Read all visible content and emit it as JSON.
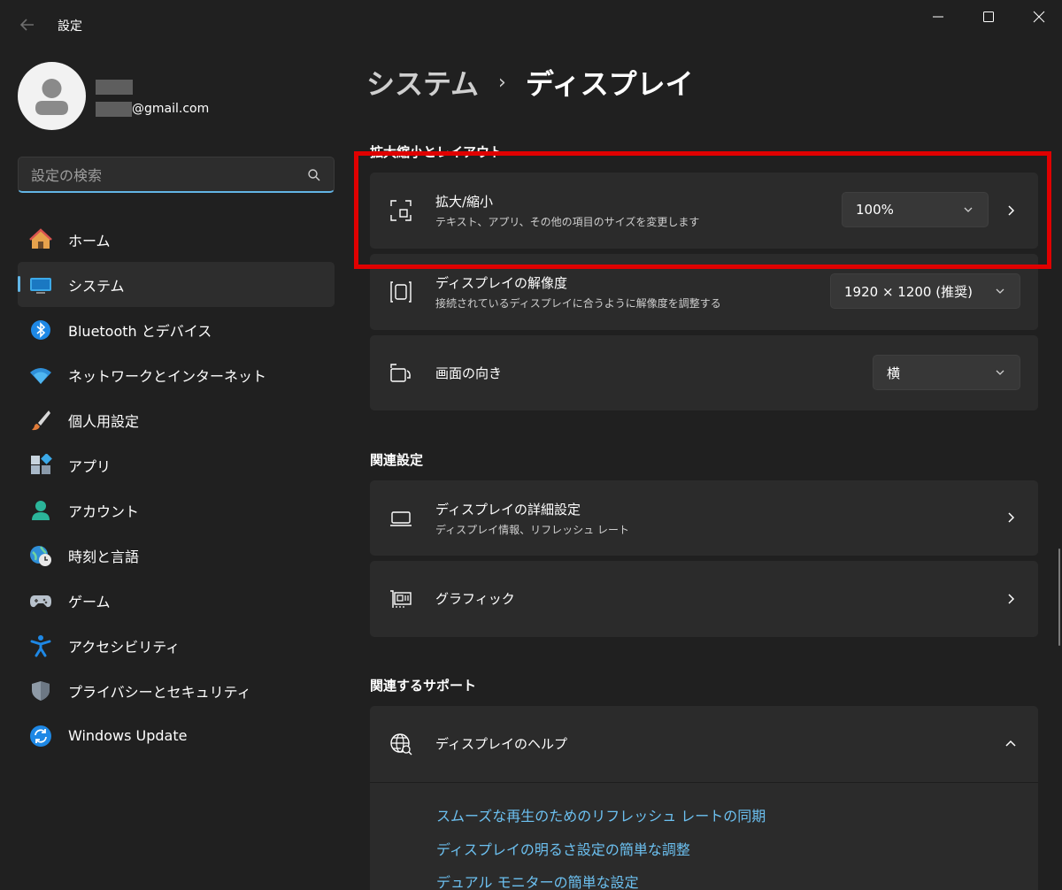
{
  "app": {
    "title": "設定"
  },
  "user": {
    "email_suffix": "@gmail.com"
  },
  "search": {
    "placeholder": "設定の検索"
  },
  "sidebar": {
    "items": [
      {
        "label": "ホーム",
        "icon": "home-icon"
      },
      {
        "label": "システム",
        "icon": "system-icon",
        "active": true
      },
      {
        "label": "Bluetooth とデバイス",
        "icon": "bluetooth-icon"
      },
      {
        "label": "ネットワークとインターネット",
        "icon": "wifi-icon"
      },
      {
        "label": "個人用設定",
        "icon": "brush-icon"
      },
      {
        "label": "アプリ",
        "icon": "apps-icon"
      },
      {
        "label": "アカウント",
        "icon": "account-icon"
      },
      {
        "label": "時刻と言語",
        "icon": "time-language-icon"
      },
      {
        "label": "ゲーム",
        "icon": "gamepad-icon"
      },
      {
        "label": "アクセシビリティ",
        "icon": "accessibility-icon"
      },
      {
        "label": "プライバシーとセキュリティ",
        "icon": "shield-icon"
      },
      {
        "label": "Windows Update",
        "icon": "update-icon"
      }
    ]
  },
  "breadcrumb": {
    "parent": "システム",
    "separator": "›",
    "current": "ディスプレイ"
  },
  "sections": {
    "scale_layout": "拡大縮小とレイアウト",
    "related_settings": "関連設定",
    "related_support": "関連するサポート"
  },
  "scale": {
    "title": "拡大/縮小",
    "subtitle": "テキスト、アプリ、その他の項目のサイズを変更します",
    "value": "100%"
  },
  "resolution": {
    "title": "ディスプレイの解像度",
    "subtitle": "接続されているディスプレイに合うように解像度を調整する",
    "value": "1920 × 1200 (推奨)"
  },
  "orientation": {
    "title": "画面の向き",
    "value": "横"
  },
  "advanced_display": {
    "title": "ディスプレイの詳細設定",
    "subtitle": "ディスプレイ情報、リフレッシュ レート"
  },
  "graphics": {
    "title": "グラフィック"
  },
  "help": {
    "title": "ディスプレイのヘルプ",
    "links": [
      "スムーズな再生のためのリフレッシュ レートの同期",
      "ディスプレイの明るさ設定の簡単な調整",
      "デュアル モニターの簡単な設定"
    ]
  },
  "colors": {
    "accent": "#62b5e5",
    "highlight_box": "#e00000",
    "link": "#6cc0f0"
  }
}
